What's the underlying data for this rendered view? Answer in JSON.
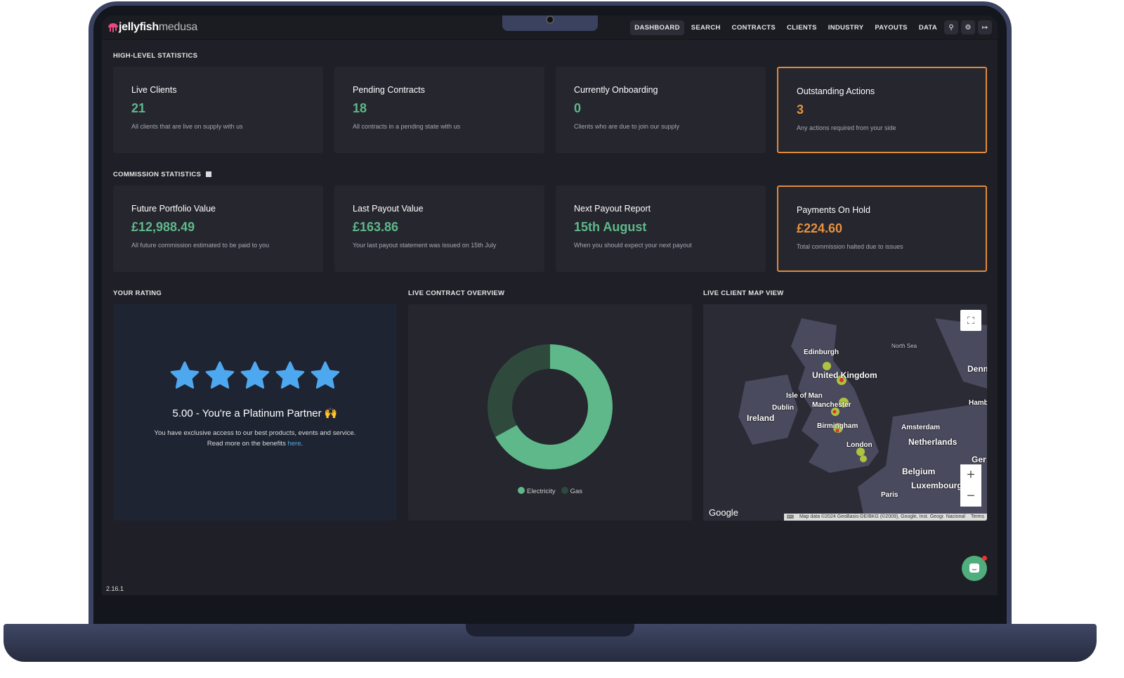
{
  "brand": {
    "name_bold": "jellyfish",
    "name_light": "medusa"
  },
  "nav": {
    "items": [
      "DASHBOARD",
      "SEARCH",
      "CONTRACTS",
      "CLIENTS",
      "INDUSTRY",
      "PAYOUTS",
      "DATA"
    ],
    "active": "DASHBOARD",
    "icons": [
      "search-icon",
      "gear-icon",
      "logout-icon"
    ]
  },
  "sections": {
    "high": "HIGH-LEVEL STATISTICS",
    "commission": "COMMISSION STATISTICS",
    "rating": "YOUR RATING",
    "contracts": "LIVE CONTRACT OVERVIEW",
    "map": "LIVE CLIENT MAP VIEW"
  },
  "high_cards": [
    {
      "title": "Live Clients",
      "value": "21",
      "desc": "All clients that are live on supply with us"
    },
    {
      "title": "Pending Contracts",
      "value": "18",
      "desc": "All contracts in a pending state with us"
    },
    {
      "title": "Currently Onboarding",
      "value": "0",
      "desc": "Clients who are due to join our supply"
    },
    {
      "title": "Outstanding Actions",
      "value": "3",
      "desc": "Any actions required from your side"
    }
  ],
  "commission_cards": [
    {
      "title": "Future Portfolio Value",
      "value": "£12,988.49",
      "desc": "All future commission estimated to be paid to you"
    },
    {
      "title": "Last Payout Value",
      "value": "£163.86",
      "desc": "Your last payout statement was issued on 15th July"
    },
    {
      "title": "Next Payout Report",
      "value": "15th August",
      "desc": "When you should expect your next payout"
    },
    {
      "title": "Payments On Hold",
      "value": "£224.60",
      "desc": "Total commission halted due to issues"
    }
  ],
  "rating": {
    "stars": 5,
    "max": 5,
    "title": "5.00 - You're a Platinum Partner 🙌",
    "line1": "You have exclusive access to our best products, events and service.",
    "line2_pre": "Read more on the benefits ",
    "link": "here",
    "line2_post": "."
  },
  "chart_data": {
    "type": "pie",
    "donut": true,
    "series": [
      {
        "name": "Electricity",
        "value": 67,
        "color": "#5fb88a"
      },
      {
        "name": "Gas",
        "value": 33,
        "color": "#2f4a3d"
      }
    ],
    "legend": "bottom"
  },
  "map": {
    "labels": [
      "Edinburgh",
      "United Kingdom",
      "Isle of Man",
      "Dublin",
      "Ireland",
      "Manchester",
      "Birmingham",
      "London",
      "Amsterdam",
      "Netherlands",
      "Belgium",
      "Luxembourg",
      "Paris",
      "North Sea",
      "Denm",
      "Hamb",
      "Ger"
    ],
    "logo": "Google",
    "attribution": "Map data ©2024 GeoBasis-DE/BKG (©2009), Google, Inst. Geogr. Nacional",
    "terms": "Terms"
  },
  "version": "2.16.1",
  "colors": {
    "accent": "#5fb88a",
    "warning": "#e8913f",
    "star": "#4ea8f0"
  }
}
